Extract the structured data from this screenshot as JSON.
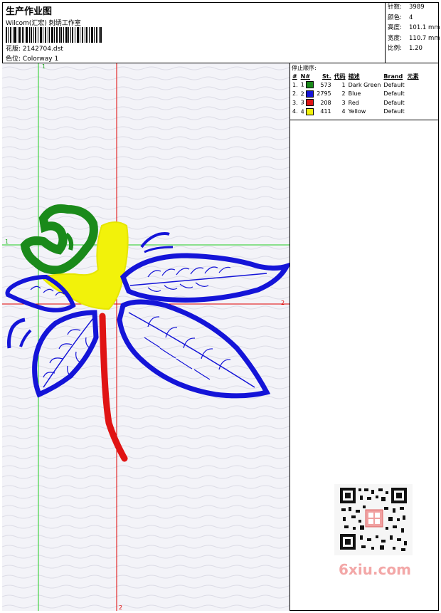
{
  "header": {
    "title": "生产作业图",
    "subtitle": "Wilcom(汇宏) 刺绣工作室",
    "design_label": "花版:",
    "design_value": "2142704.dst",
    "colorway_label": "色位:",
    "colorway_value": "Colorway 1"
  },
  "stats": [
    {
      "label": "针数:",
      "value": "3989"
    },
    {
      "label": "颜色:",
      "value": "4"
    },
    {
      "label": "高度:",
      "value": "101.1 mm"
    },
    {
      "label": "宽度:",
      "value": "110.7 mm"
    },
    {
      "label": "比例:",
      "value": "1.20"
    }
  ],
  "stop_sequence": {
    "title": "停止顺序:",
    "headers": [
      "#",
      "N#",
      "St.",
      "代码",
      "描述",
      "Brand",
      "元素"
    ],
    "rows": [
      {
        "idx": "1.",
        "n": "1",
        "color": "#1a8a1a",
        "st": "573",
        "code": "1",
        "desc": "Dark Green",
        "brand": "Default"
      },
      {
        "idx": "2.",
        "n": "2",
        "color": "#1414d8",
        "st": "2795",
        "code": "2",
        "desc": "Blue",
        "brand": "Default"
      },
      {
        "idx": "3.",
        "n": "3",
        "color": "#e01414",
        "st": "208",
        "code": "3",
        "desc": "Red",
        "brand": "Default"
      },
      {
        "idx": "4.",
        "n": "4",
        "color": "#f2f20a",
        "st": "411",
        "code": "4",
        "desc": "Yellow",
        "brand": "Default"
      }
    ]
  },
  "guides": {
    "v1_label": "1",
    "h1_label": "1",
    "h2_label": "2",
    "v2_label": "2"
  },
  "watermark": {
    "text": "6xiu.com"
  },
  "colors": {
    "green": "#1a8a1a",
    "blue": "#1414d8",
    "red": "#e01414",
    "yellow": "#f2f20a",
    "guide_green": "#22cc22",
    "guide_red": "#e00000"
  }
}
